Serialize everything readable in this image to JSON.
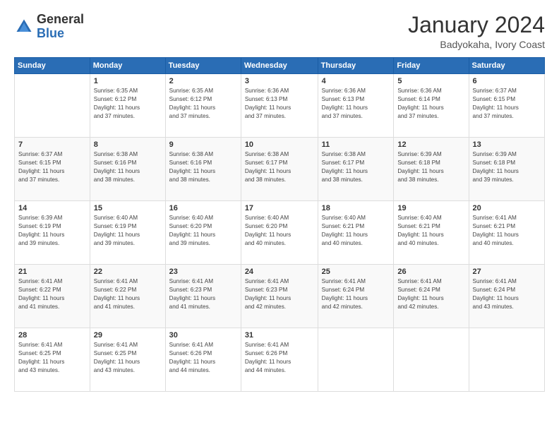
{
  "header": {
    "logo_general": "General",
    "logo_blue": "Blue",
    "title": "January 2024",
    "location": "Badyokaha, Ivory Coast"
  },
  "weekdays": [
    "Sunday",
    "Monday",
    "Tuesday",
    "Wednesday",
    "Thursday",
    "Friday",
    "Saturday"
  ],
  "weeks": [
    [
      {
        "day": "",
        "info": ""
      },
      {
        "day": "1",
        "info": "Sunrise: 6:35 AM\nSunset: 6:12 PM\nDaylight: 11 hours\nand 37 minutes."
      },
      {
        "day": "2",
        "info": "Sunrise: 6:35 AM\nSunset: 6:12 PM\nDaylight: 11 hours\nand 37 minutes."
      },
      {
        "day": "3",
        "info": "Sunrise: 6:36 AM\nSunset: 6:13 PM\nDaylight: 11 hours\nand 37 minutes."
      },
      {
        "day": "4",
        "info": "Sunrise: 6:36 AM\nSunset: 6:13 PM\nDaylight: 11 hours\nand 37 minutes."
      },
      {
        "day": "5",
        "info": "Sunrise: 6:36 AM\nSunset: 6:14 PM\nDaylight: 11 hours\nand 37 minutes."
      },
      {
        "day": "6",
        "info": "Sunrise: 6:37 AM\nSunset: 6:15 PM\nDaylight: 11 hours\nand 37 minutes."
      }
    ],
    [
      {
        "day": "7",
        "info": "Sunrise: 6:37 AM\nSunset: 6:15 PM\nDaylight: 11 hours\nand 37 minutes."
      },
      {
        "day": "8",
        "info": "Sunrise: 6:38 AM\nSunset: 6:16 PM\nDaylight: 11 hours\nand 38 minutes."
      },
      {
        "day": "9",
        "info": "Sunrise: 6:38 AM\nSunset: 6:16 PM\nDaylight: 11 hours\nand 38 minutes."
      },
      {
        "day": "10",
        "info": "Sunrise: 6:38 AM\nSunset: 6:17 PM\nDaylight: 11 hours\nand 38 minutes."
      },
      {
        "day": "11",
        "info": "Sunrise: 6:38 AM\nSunset: 6:17 PM\nDaylight: 11 hours\nand 38 minutes."
      },
      {
        "day": "12",
        "info": "Sunrise: 6:39 AM\nSunset: 6:18 PM\nDaylight: 11 hours\nand 38 minutes."
      },
      {
        "day": "13",
        "info": "Sunrise: 6:39 AM\nSunset: 6:18 PM\nDaylight: 11 hours\nand 39 minutes."
      }
    ],
    [
      {
        "day": "14",
        "info": "Sunrise: 6:39 AM\nSunset: 6:19 PM\nDaylight: 11 hours\nand 39 minutes."
      },
      {
        "day": "15",
        "info": "Sunrise: 6:40 AM\nSunset: 6:19 PM\nDaylight: 11 hours\nand 39 minutes."
      },
      {
        "day": "16",
        "info": "Sunrise: 6:40 AM\nSunset: 6:20 PM\nDaylight: 11 hours\nand 39 minutes."
      },
      {
        "day": "17",
        "info": "Sunrise: 6:40 AM\nSunset: 6:20 PM\nDaylight: 11 hours\nand 40 minutes."
      },
      {
        "day": "18",
        "info": "Sunrise: 6:40 AM\nSunset: 6:21 PM\nDaylight: 11 hours\nand 40 minutes."
      },
      {
        "day": "19",
        "info": "Sunrise: 6:40 AM\nSunset: 6:21 PM\nDaylight: 11 hours\nand 40 minutes."
      },
      {
        "day": "20",
        "info": "Sunrise: 6:41 AM\nSunset: 6:21 PM\nDaylight: 11 hours\nand 40 minutes."
      }
    ],
    [
      {
        "day": "21",
        "info": "Sunrise: 6:41 AM\nSunset: 6:22 PM\nDaylight: 11 hours\nand 41 minutes."
      },
      {
        "day": "22",
        "info": "Sunrise: 6:41 AM\nSunset: 6:22 PM\nDaylight: 11 hours\nand 41 minutes."
      },
      {
        "day": "23",
        "info": "Sunrise: 6:41 AM\nSunset: 6:23 PM\nDaylight: 11 hours\nand 41 minutes."
      },
      {
        "day": "24",
        "info": "Sunrise: 6:41 AM\nSunset: 6:23 PM\nDaylight: 11 hours\nand 42 minutes."
      },
      {
        "day": "25",
        "info": "Sunrise: 6:41 AM\nSunset: 6:24 PM\nDaylight: 11 hours\nand 42 minutes."
      },
      {
        "day": "26",
        "info": "Sunrise: 6:41 AM\nSunset: 6:24 PM\nDaylight: 11 hours\nand 42 minutes."
      },
      {
        "day": "27",
        "info": "Sunrise: 6:41 AM\nSunset: 6:24 PM\nDaylight: 11 hours\nand 43 minutes."
      }
    ],
    [
      {
        "day": "28",
        "info": "Sunrise: 6:41 AM\nSunset: 6:25 PM\nDaylight: 11 hours\nand 43 minutes."
      },
      {
        "day": "29",
        "info": "Sunrise: 6:41 AM\nSunset: 6:25 PM\nDaylight: 11 hours\nand 43 minutes."
      },
      {
        "day": "30",
        "info": "Sunrise: 6:41 AM\nSunset: 6:26 PM\nDaylight: 11 hours\nand 44 minutes."
      },
      {
        "day": "31",
        "info": "Sunrise: 6:41 AM\nSunset: 6:26 PM\nDaylight: 11 hours\nand 44 minutes."
      },
      {
        "day": "",
        "info": ""
      },
      {
        "day": "",
        "info": ""
      },
      {
        "day": "",
        "info": ""
      }
    ]
  ]
}
